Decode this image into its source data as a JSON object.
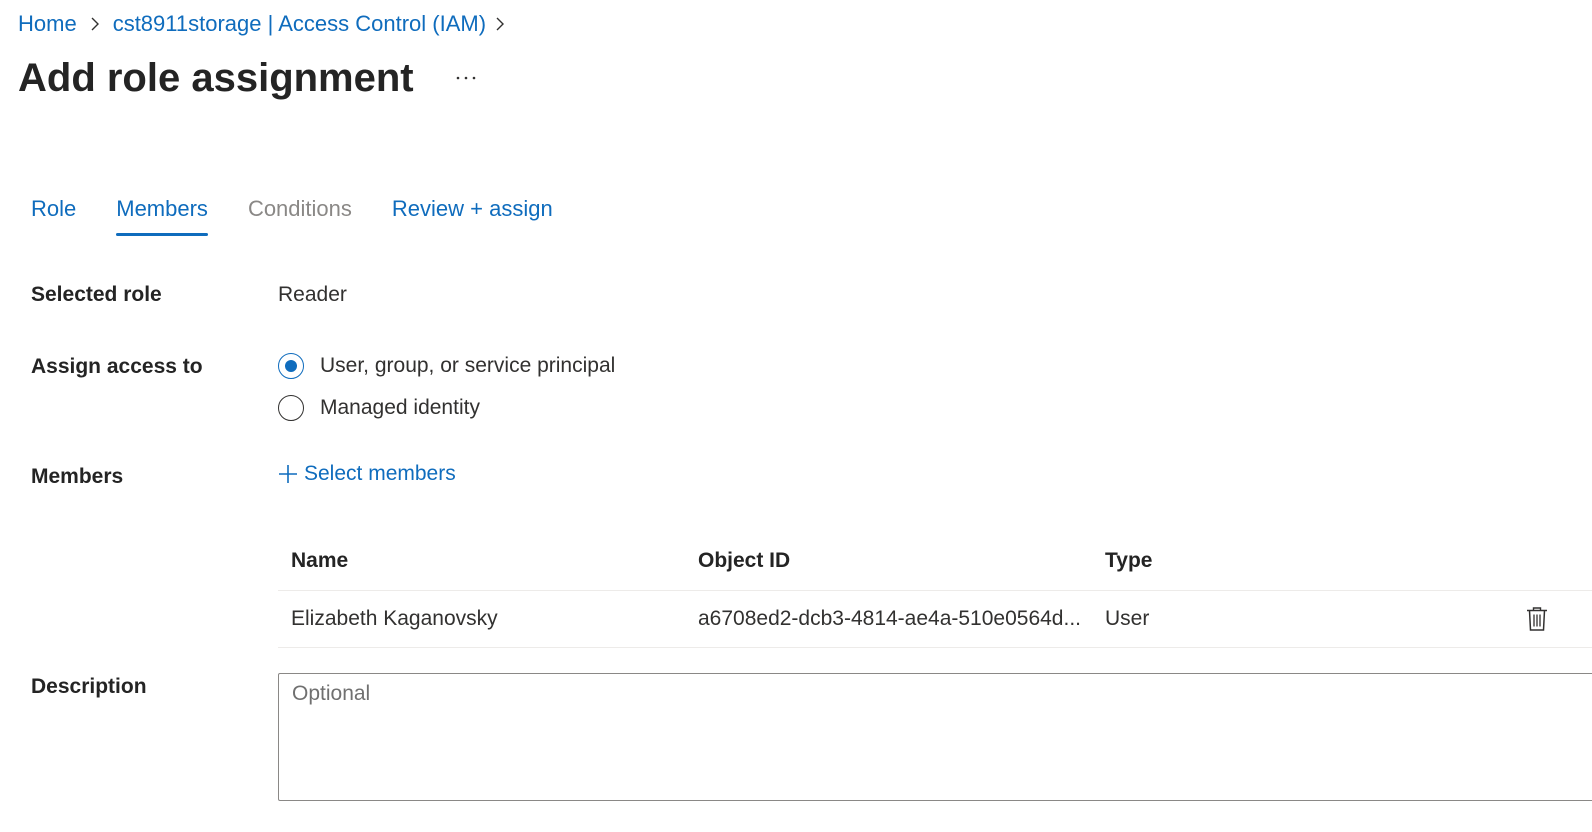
{
  "colors": {
    "link": "#0f6cbd",
    "text": "#323130",
    "disabled": "#8a8886"
  },
  "breadcrumb": {
    "items": [
      {
        "label": "Home"
      },
      {
        "label": "cst8911storage | Access Control (IAM)"
      }
    ],
    "separator_icon": "chevron-right-icon"
  },
  "header": {
    "title": "Add role assignment",
    "more_icon": "ellipsis-icon",
    "more_text": "···"
  },
  "tabs": [
    {
      "label": "Role",
      "state": "link"
    },
    {
      "label": "Members",
      "state": "active"
    },
    {
      "label": "Conditions",
      "state": "disabled"
    },
    {
      "label": "Review + assign",
      "state": "link"
    }
  ],
  "form": {
    "selected_role": {
      "label": "Selected role",
      "value": "Reader"
    },
    "assign_access": {
      "label": "Assign access to",
      "options": [
        {
          "label": "User, group, or service principal",
          "checked": true
        },
        {
          "label": "Managed identity",
          "checked": false
        }
      ]
    },
    "members": {
      "label": "Members",
      "select_label": "Select members",
      "select_icon": "plus-icon"
    },
    "members_table": {
      "columns": [
        "Name",
        "Object ID",
        "Type"
      ],
      "rows": [
        {
          "name": "Elizabeth Kaganovsky",
          "object_id": "a6708ed2-dcb3-4814-ae4a-510e0564d...",
          "type": "User",
          "action_icon": "trash-icon"
        }
      ]
    },
    "description": {
      "label": "Description",
      "placeholder": "Optional",
      "value": ""
    }
  }
}
